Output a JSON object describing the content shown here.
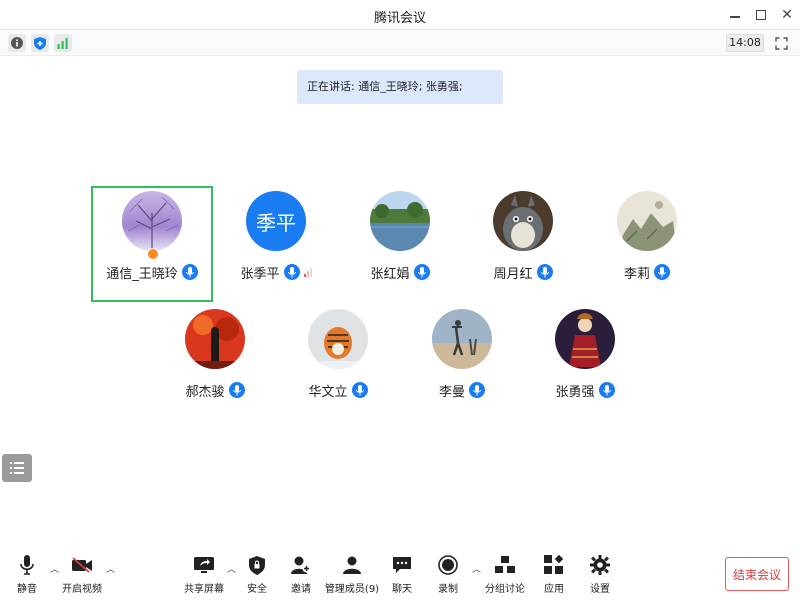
{
  "window": {
    "title": "腾讯会议"
  },
  "toolbar": {
    "time": "14:08"
  },
  "speaking_banner": {
    "text": "正在讲话: 通信_王晓玲; 张勇强;"
  },
  "participants": [
    {
      "name": "通信_王晓玲",
      "avatar_text": ""
    },
    {
      "name": "张季平",
      "avatar_text": "季平"
    },
    {
      "name": "张红娟",
      "avatar_text": ""
    },
    {
      "name": "周月红",
      "avatar_text": ""
    },
    {
      "name": "李莉",
      "avatar_text": ""
    },
    {
      "name": "郝杰骏",
      "avatar_text": ""
    },
    {
      "name": "华文立",
      "avatar_text": ""
    },
    {
      "name": "李曼",
      "avatar_text": ""
    },
    {
      "name": "张勇强",
      "avatar_text": ""
    }
  ],
  "bottom": {
    "mute": "静音",
    "video": "开启视频",
    "share": "共享屏幕",
    "security": "安全",
    "invite": "邀请",
    "members": "管理成员(9)",
    "chat": "聊天",
    "record": "录制",
    "breakout": "分组讨论",
    "apps": "应用",
    "settings": "设置",
    "end": "结束会议"
  },
  "colors": {
    "accent": "#1a7cf2",
    "active_border": "#2fbf5b",
    "banner_bg": "#dbe8fb",
    "end_red": "#d83b3b",
    "host_badge": "#ff8a1f"
  }
}
